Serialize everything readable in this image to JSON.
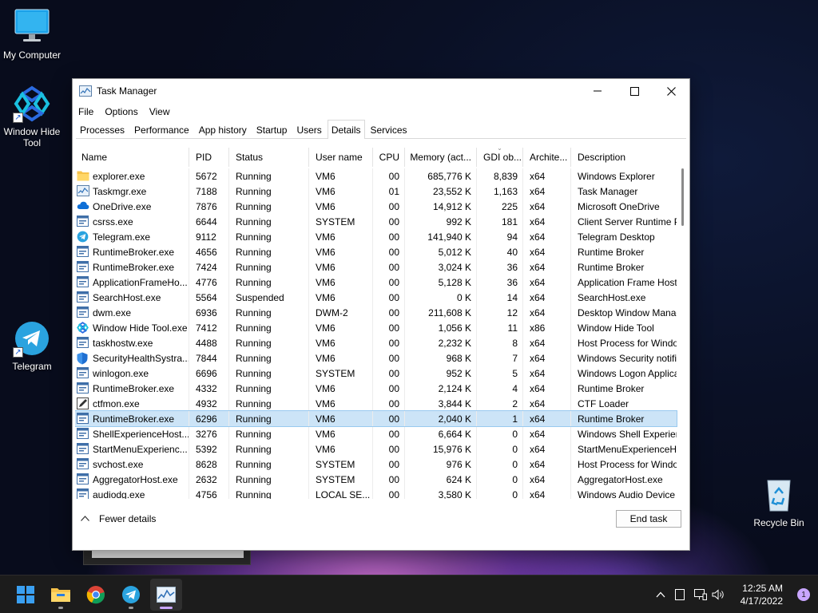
{
  "desktop": {
    "icons": [
      {
        "label": "My Computer"
      },
      {
        "label": "Window Hide Tool"
      },
      {
        "label": "Telegram"
      },
      {
        "label": "Recycle Bin"
      }
    ]
  },
  "window": {
    "title": "Task Manager",
    "menu": [
      "File",
      "Options",
      "View"
    ],
    "tabs": [
      "Processes",
      "Performance",
      "App history",
      "Startup",
      "Users",
      "Details",
      "Services"
    ],
    "active_tab": "Details",
    "columns": [
      "Name",
      "PID",
      "Status",
      "User name",
      "CPU",
      "Memory (act...",
      "GDI ob...",
      "Archite...",
      "Description"
    ],
    "selected_row": 16,
    "rows": [
      {
        "name": "explorer.exe",
        "pid": "5672",
        "status": "Running",
        "user": "VM6",
        "cpu": "00",
        "mem": "685,776 K",
        "gdi": "8,839",
        "arch": "x64",
        "desc": "Windows Explorer",
        "icon": "folder-icon"
      },
      {
        "name": "Taskmgr.exe",
        "pid": "7188",
        "status": "Running",
        "user": "VM6",
        "cpu": "01",
        "mem": "23,552 K",
        "gdi": "1,163",
        "arch": "x64",
        "desc": "Task Manager",
        "icon": "task-manager-icon"
      },
      {
        "name": "OneDrive.exe",
        "pid": "7876",
        "status": "Running",
        "user": "VM6",
        "cpu": "00",
        "mem": "14,912 K",
        "gdi": "225",
        "arch": "x64",
        "desc": "Microsoft OneDrive",
        "icon": "cloud-icon"
      },
      {
        "name": "csrss.exe",
        "pid": "6644",
        "status": "Running",
        "user": "SYSTEM",
        "cpu": "00",
        "mem": "992 K",
        "gdi": "181",
        "arch": "x64",
        "desc": "Client Server Runtime Pr",
        "icon": "app-window-icon"
      },
      {
        "name": "Telegram.exe",
        "pid": "9112",
        "status": "Running",
        "user": "VM6",
        "cpu": "00",
        "mem": "141,940 K",
        "gdi": "94",
        "arch": "x64",
        "desc": "Telegram Desktop",
        "icon": "telegram-icon"
      },
      {
        "name": "RuntimeBroker.exe",
        "pid": "4656",
        "status": "Running",
        "user": "VM6",
        "cpu": "00",
        "mem": "5,012 K",
        "gdi": "40",
        "arch": "x64",
        "desc": "Runtime Broker",
        "icon": "app-window-icon"
      },
      {
        "name": "RuntimeBroker.exe",
        "pid": "7424",
        "status": "Running",
        "user": "VM6",
        "cpu": "00",
        "mem": "3,024 K",
        "gdi": "36",
        "arch": "x64",
        "desc": "Runtime Broker",
        "icon": "app-window-icon"
      },
      {
        "name": "ApplicationFrameHo...",
        "pid": "4776",
        "status": "Running",
        "user": "VM6",
        "cpu": "00",
        "mem": "5,128 K",
        "gdi": "36",
        "arch": "x64",
        "desc": "Application Frame Host",
        "icon": "app-window-icon"
      },
      {
        "name": "SearchHost.exe",
        "pid": "5564",
        "status": "Suspended",
        "user": "VM6",
        "cpu": "00",
        "mem": "0 K",
        "gdi": "14",
        "arch": "x64",
        "desc": "SearchHost.exe",
        "icon": "app-window-icon"
      },
      {
        "name": "dwm.exe",
        "pid": "6936",
        "status": "Running",
        "user": "DWM-2",
        "cpu": "00",
        "mem": "211,608 K",
        "gdi": "12",
        "arch": "x64",
        "desc": "Desktop Window Manag",
        "icon": "app-window-icon"
      },
      {
        "name": "Window Hide Tool.exe",
        "pid": "7412",
        "status": "Running",
        "user": "VM6",
        "cpu": "00",
        "mem": "1,056 K",
        "gdi": "11",
        "arch": "x86",
        "desc": "Window Hide Tool",
        "icon": "window-hide-tool-icon"
      },
      {
        "name": "taskhostw.exe",
        "pid": "4488",
        "status": "Running",
        "user": "VM6",
        "cpu": "00",
        "mem": "2,232 K",
        "gdi": "8",
        "arch": "x64",
        "desc": "Host Process for Window",
        "icon": "app-window-icon"
      },
      {
        "name": "SecurityHealthSystra...",
        "pid": "7844",
        "status": "Running",
        "user": "VM6",
        "cpu": "00",
        "mem": "968 K",
        "gdi": "7",
        "arch": "x64",
        "desc": "Windows Security notifi",
        "icon": "shield-icon"
      },
      {
        "name": "winlogon.exe",
        "pid": "6696",
        "status": "Running",
        "user": "SYSTEM",
        "cpu": "00",
        "mem": "952 K",
        "gdi": "5",
        "arch": "x64",
        "desc": "Windows Logon Applica",
        "icon": "app-window-icon"
      },
      {
        "name": "RuntimeBroker.exe",
        "pid": "4332",
        "status": "Running",
        "user": "VM6",
        "cpu": "00",
        "mem": "2,124 K",
        "gdi": "4",
        "arch": "x64",
        "desc": "Runtime Broker",
        "icon": "app-window-icon"
      },
      {
        "name": "ctfmon.exe",
        "pid": "4932",
        "status": "Running",
        "user": "VM6",
        "cpu": "00",
        "mem": "3,844 K",
        "gdi": "2",
        "arch": "x64",
        "desc": "CTF Loader",
        "icon": "pen-icon"
      },
      {
        "name": "RuntimeBroker.exe",
        "pid": "6296",
        "status": "Running",
        "user": "VM6",
        "cpu": "00",
        "mem": "2,040 K",
        "gdi": "1",
        "arch": "x64",
        "desc": "Runtime Broker",
        "icon": "app-window-icon"
      },
      {
        "name": "ShellExperienceHost....",
        "pid": "3276",
        "status": "Running",
        "user": "VM6",
        "cpu": "00",
        "mem": "6,664 K",
        "gdi": "0",
        "arch": "x64",
        "desc": "Windows Shell Experien",
        "icon": "app-window-icon"
      },
      {
        "name": "StartMenuExperienc...",
        "pid": "5392",
        "status": "Running",
        "user": "VM6",
        "cpu": "00",
        "mem": "15,976 K",
        "gdi": "0",
        "arch": "x64",
        "desc": "StartMenuExperienceHo",
        "icon": "app-window-icon"
      },
      {
        "name": "svchost.exe",
        "pid": "8628",
        "status": "Running",
        "user": "SYSTEM",
        "cpu": "00",
        "mem": "976 K",
        "gdi": "0",
        "arch": "x64",
        "desc": "Host Process for Window",
        "icon": "app-window-icon"
      },
      {
        "name": "AggregatorHost.exe",
        "pid": "2632",
        "status": "Running",
        "user": "SYSTEM",
        "cpu": "00",
        "mem": "624 K",
        "gdi": "0",
        "arch": "x64",
        "desc": "AggregatorHost.exe",
        "icon": "app-window-icon"
      },
      {
        "name": "audiodg.exe",
        "pid": "4756",
        "status": "Running",
        "user": "LOCAL SE...",
        "cpu": "00",
        "mem": "3,580 K",
        "gdi": "0",
        "arch": "x64",
        "desc": "Windows Audio Device",
        "icon": "app-window-icon"
      }
    ],
    "footer": {
      "fewer_details": "Fewer details",
      "end_task": "End task"
    }
  },
  "taskbar": {
    "clock_time": "12:25 AM",
    "clock_date": "4/17/2022",
    "notification_count": "1",
    "accent": "#c9a6ff"
  }
}
